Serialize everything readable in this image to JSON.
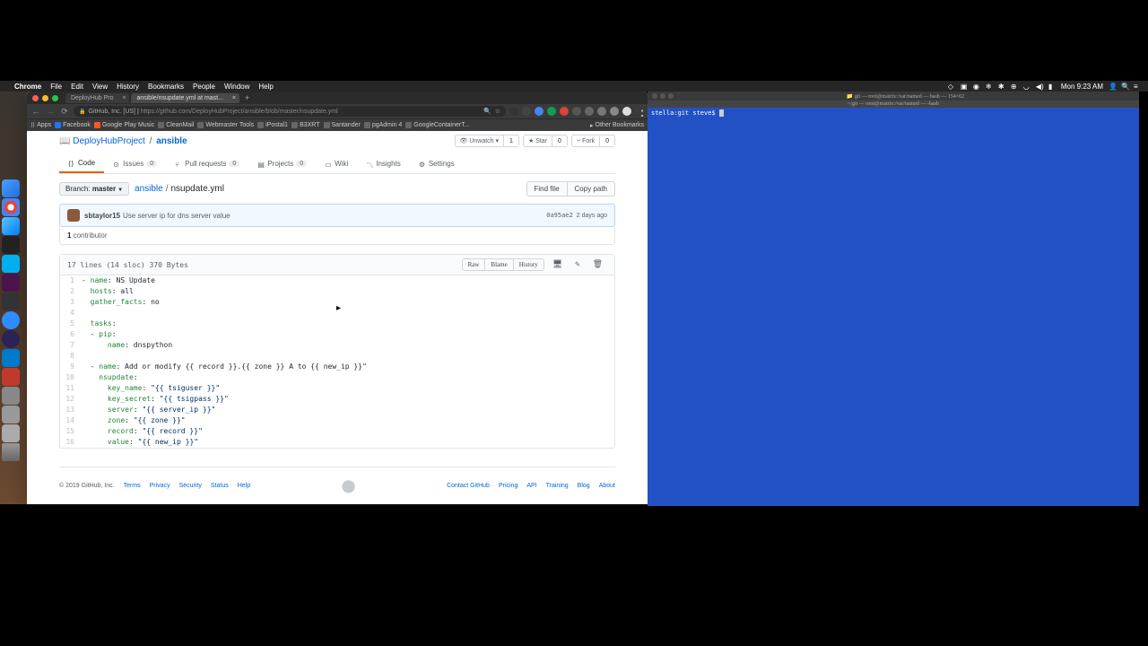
{
  "menubar": {
    "app": "Chrome",
    "items": [
      "File",
      "Edit",
      "View",
      "History",
      "Bookmarks",
      "People",
      "Window",
      "Help"
    ],
    "clock": "Mon 9:23 AM"
  },
  "tabs": [
    {
      "title": "DeployHub Pro",
      "active": false
    },
    {
      "title": "ansible/nsupdate.yml at mast...",
      "active": true
    }
  ],
  "url": {
    "domain": "GitHub, Inc. [US]",
    "full": "https://github.com/DeployHubProject/ansible/blob/master/nsupdate.yml"
  },
  "bookmarks": {
    "apps": "Apps",
    "items": [
      "Facebook",
      "Google Play Music",
      "CleanMail",
      "Webmaster Tools",
      "iPostal1",
      "B3XRT",
      "Santander",
      "pgAdmin 4",
      "GoogleContainerT..."
    ],
    "other": "Other Bookmarks"
  },
  "github": {
    "org": "DeployHubProject",
    "repo": "ansible",
    "watch_label": "Unwatch",
    "watch_count": "1",
    "star_label": "Star",
    "star_count": "0",
    "fork_label": "Fork",
    "fork_count": "0",
    "tabs": {
      "code": "Code",
      "issues": "Issues",
      "issues_count": "0",
      "prs": "Pull requests",
      "prs_count": "0",
      "projects": "Projects",
      "projects_count": "0",
      "wiki": "Wiki",
      "insights": "Insights",
      "settings": "Settings"
    },
    "branch_label": "Branch:",
    "branch": "master",
    "path_folder": "ansible",
    "path_file": "nsupdate.yml",
    "find_file": "Find file",
    "copy_path": "Copy path",
    "author": "sbtaylor15",
    "commit_msg": "Use server ip for dns server value",
    "commit_hash": "0a95ae2",
    "commit_date": "2 days ago",
    "contributors": "1",
    "contributors_label": "contributor",
    "stats": "17 lines (14 sloc)  370 Bytes",
    "raw": "Raw",
    "blame": "Blame",
    "history": "History",
    "code_lines": [
      {
        "n": "1",
        "text": "- name: NS Update",
        "cls": "pl-ent"
      },
      {
        "n": "2",
        "text": "  hosts: all",
        "cls": ""
      },
      {
        "n": "3",
        "text": "  gather_facts: no",
        "cls": ""
      },
      {
        "n": "4",
        "text": "",
        "cls": ""
      },
      {
        "n": "5",
        "text": "  tasks:",
        "cls": ""
      },
      {
        "n": "6",
        "text": "  - pip:",
        "cls": ""
      },
      {
        "n": "7",
        "text": "      name: dnspython",
        "cls": ""
      },
      {
        "n": "8",
        "text": "",
        "cls": ""
      },
      {
        "n": "9",
        "text": "  - name: Add or modify {{ record }}.{{ zone }} A to {{ new_ip }}\"",
        "cls": ""
      },
      {
        "n": "10",
        "text": "    nsupdate:",
        "cls": ""
      },
      {
        "n": "11",
        "text": "      key_name: \"{{ tsiguser }}\"",
        "cls": ""
      },
      {
        "n": "12",
        "text": "      key_secret: \"{{ tsigpass }}\"",
        "cls": ""
      },
      {
        "n": "13",
        "text": "      server: \"{{ server_ip }}\"",
        "cls": ""
      },
      {
        "n": "14",
        "text": "      zone: \"{{ zone }}\"",
        "cls": ""
      },
      {
        "n": "15",
        "text": "      record: \"{{ record }}\"",
        "cls": ""
      },
      {
        "n": "16",
        "text": "      value: \"{{ new_ip }}\"",
        "cls": ""
      }
    ],
    "footer": {
      "copyright": "© 2019 GitHub, Inc.",
      "left": [
        "Terms",
        "Privacy",
        "Security",
        "Status",
        "Help"
      ],
      "right": [
        "Contact GitHub",
        "Pricing",
        "API",
        "Training",
        "Blog",
        "About"
      ]
    }
  },
  "terminal": {
    "title_right": "git — root@matrix:/var/named — bash — 154×62",
    "subtitle": "~/git — root@matrix:/var/named — -bash",
    "prompt": "stella:git steve$ ",
    "command": ""
  }
}
